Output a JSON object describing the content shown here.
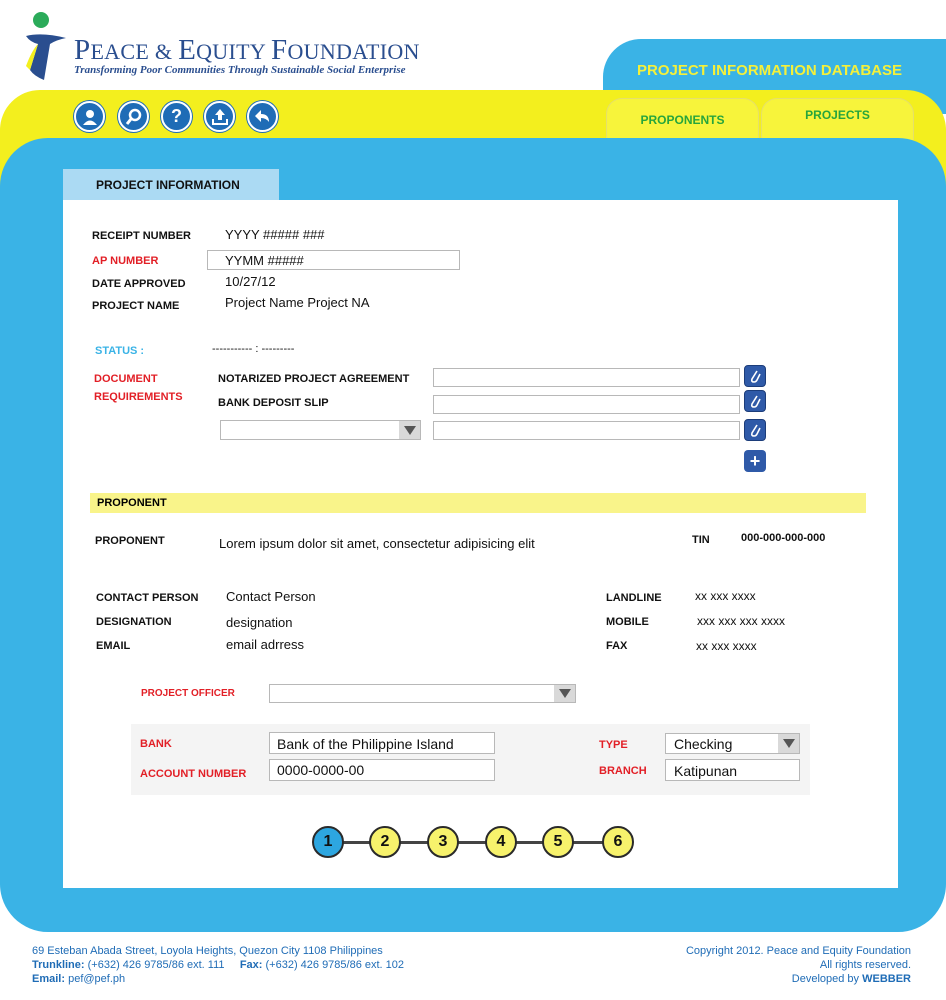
{
  "header": {
    "org_name_first": "P",
    "org_name_rest": "EACE & ",
    "org_name_e": "E",
    "org_name_quity": "QUITY ",
    "org_name_f": "F",
    "org_name_oundation": "OUNDATION",
    "tagline": "Transforming Poor Communities Through Sustainable Social Enterprise",
    "database_title": "PROJECT INFORMATION DATABASE"
  },
  "toolbar": {
    "icons": [
      "user-icon",
      "search-icon",
      "help-icon",
      "upload-icon",
      "back-icon"
    ]
  },
  "nav_tabs": [
    "PROPONENTS",
    "PROJECTS"
  ],
  "section_tab": "PROJECT INFORMATION",
  "project": {
    "receipt_label": "RECEIPT NUMBER",
    "receipt_value": "YYYY ##### ###",
    "ap_label": "AP NUMBER",
    "ap_value": "YYMM #####",
    "date_label": "DATE APPROVED",
    "date_value": "10/27/12",
    "name_label": "PROJECT NAME",
    "name_value": "Project Name Project NA",
    "status_label": "STATUS :",
    "status_value": "----------- : ---------"
  },
  "documents": {
    "label_line1": "DOCUMENT",
    "label_line2": "REQUIREMENTS",
    "items": [
      "NOTARIZED PROJECT AGREEMENT",
      "BANK DEPOSIT SLIP"
    ],
    "select_value": "",
    "add_label": "+"
  },
  "proponent_section": {
    "bar_title": "PROPONENT",
    "proponent_label": "PROPONENT",
    "proponent_value": "Lorem ipsum dolor sit amet, consectetur adipisicing elit",
    "tin_label": "TIN",
    "tin_value": "000-000-000-000",
    "contact_label": "CONTACT PERSON",
    "contact_value": "Contact Person",
    "designation_label": "DESIGNATION",
    "designation_value": "designation",
    "email_label": "EMAIL",
    "email_value": "email adrress",
    "landline_label": "LANDLINE",
    "landline_value": "xx xxx xxxx",
    "mobile_label": "MOBILE",
    "mobile_value": "xxx xxx xxx xxxx",
    "fax_label": "FAX",
    "fax_value": "xx xxx xxxx"
  },
  "officer": {
    "label": "PROJECT OFFICER",
    "value": ""
  },
  "bank": {
    "bank_label": "BANK",
    "bank_value": "Bank of the Philippine Island",
    "account_label": "ACCOUNT NUMBER",
    "account_value": "0000-0000-00",
    "type_label": "TYPE",
    "type_value": "Checking",
    "branch_label": "BRANCH",
    "branch_value": "Katipunan"
  },
  "steps": [
    "1",
    "2",
    "3",
    "4",
    "5",
    "6"
  ],
  "active_step": 1,
  "footer": {
    "address": "69 Esteban Abada Street, Loyola Heights, Quezon City 1108 Philippines",
    "trunkline_label": "Trunkline:",
    "trunkline_value": "(+632) 426 9785/86 ext. 111",
    "fax_label": "Fax:",
    "fax_value": "(+632) 426 9785/86 ext. 102",
    "email_label": "Email:",
    "email_value": "pef@pef.ph",
    "copyright": "Copyright 2012. Peace and Equity Foundation",
    "rights": "All rights reserved.",
    "developed_by": "Developed by",
    "developer": "WEBBER"
  },
  "colors": {
    "brand_blue": "#3ab3e6",
    "brand_yellow": "#f3ef1e",
    "label_red": "#e21f26",
    "nav_green": "#27a53c",
    "logo_navy": "#2a4e8f"
  }
}
